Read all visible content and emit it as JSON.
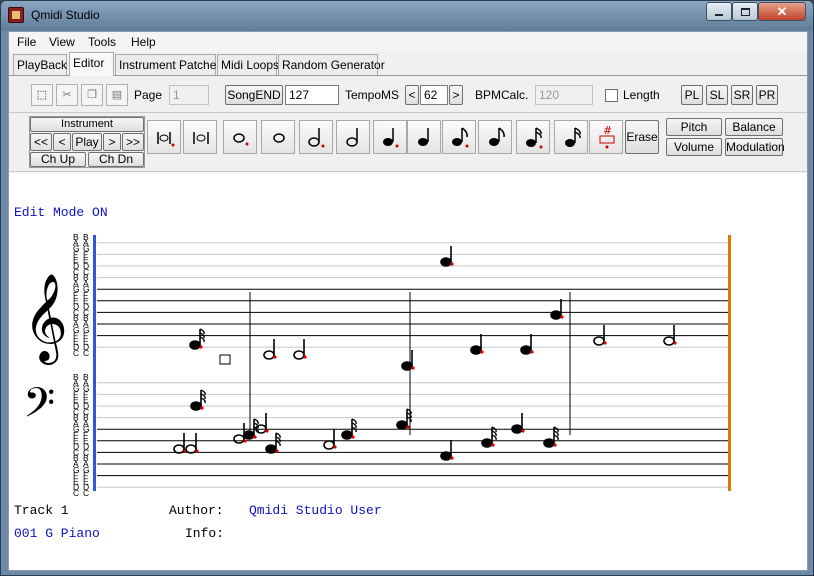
{
  "window": {
    "title": "Qmidi Studio"
  },
  "menu": [
    "File",
    "View",
    "Tools",
    "Help"
  ],
  "tabs": [
    {
      "label": "PlayBack",
      "active": false
    },
    {
      "label": "Editor",
      "active": true
    },
    {
      "label": "Instrument Patches",
      "active": false
    },
    {
      "label": "Midi Loops",
      "active": false
    },
    {
      "label": "Random Generator",
      "active": false
    }
  ],
  "toolbar": {
    "page_label": "Page",
    "page_value": "1",
    "songend_label": "SongEND",
    "songend_value": "127",
    "tempo_label": "TempoMS",
    "tempo_dec": "<",
    "tempo_value": "62",
    "tempo_inc": ">",
    "bpm_label": "BPMCalc.",
    "bpm_value": "120",
    "length_label": "Length",
    "length_checked": false,
    "view_buttons": [
      "PL",
      "SL",
      "SR",
      "PR"
    ]
  },
  "transport": {
    "instrument_label": "Instrument",
    "nav": [
      "<<",
      "<",
      "Play",
      ">",
      ">>"
    ],
    "ch_up": "Ch Up",
    "ch_dn": "Ch Dn"
  },
  "note_tools": [
    "whole-rest-dotted",
    "whole-rest",
    "whole-note-dotted",
    "whole-note",
    "half-note-dotted",
    "half-note",
    "quarter-note-dotted",
    "quarter-note",
    "eighth-note-dotted",
    "eighth-note",
    "sixteenth-note-dotted",
    "sixteenth-note",
    "sharp-note"
  ],
  "actions": {
    "erase": "Erase",
    "pitch": "Pitch",
    "balance": "Balance",
    "volume": "Volume",
    "modulation": "Modulation"
  },
  "score": {
    "mode_text": "Edit Mode ON",
    "treble_note_names": [
      "B",
      "A",
      "G",
      "F",
      "E",
      "D",
      "C",
      "B",
      "A",
      "G",
      "F",
      "E",
      "D",
      "C",
      "B",
      "A",
      "G",
      "F",
      "E",
      "D",
      "C"
    ],
    "bass_note_names": [
      "B",
      "A",
      "G",
      "F",
      "E",
      "D",
      "C",
      "B",
      "A",
      "G",
      "F",
      "E",
      "D",
      "C",
      "B",
      "A",
      "G",
      "F",
      "E",
      "D",
      "C"
    ],
    "clef_treble": "treble-clef-icon",
    "clef_bass": "bass-clef-icon",
    "accent_color": "#1010c8",
    "end_bar_color": "#e07800",
    "start_bar_color": "#3355dd"
  },
  "footer": {
    "track_label": "Track 1",
    "instrument_value": "001 G Piano",
    "author_label": "Author:",
    "author_value": "Qmidi Studio User",
    "info_label": "Info:",
    "info_value": ""
  }
}
